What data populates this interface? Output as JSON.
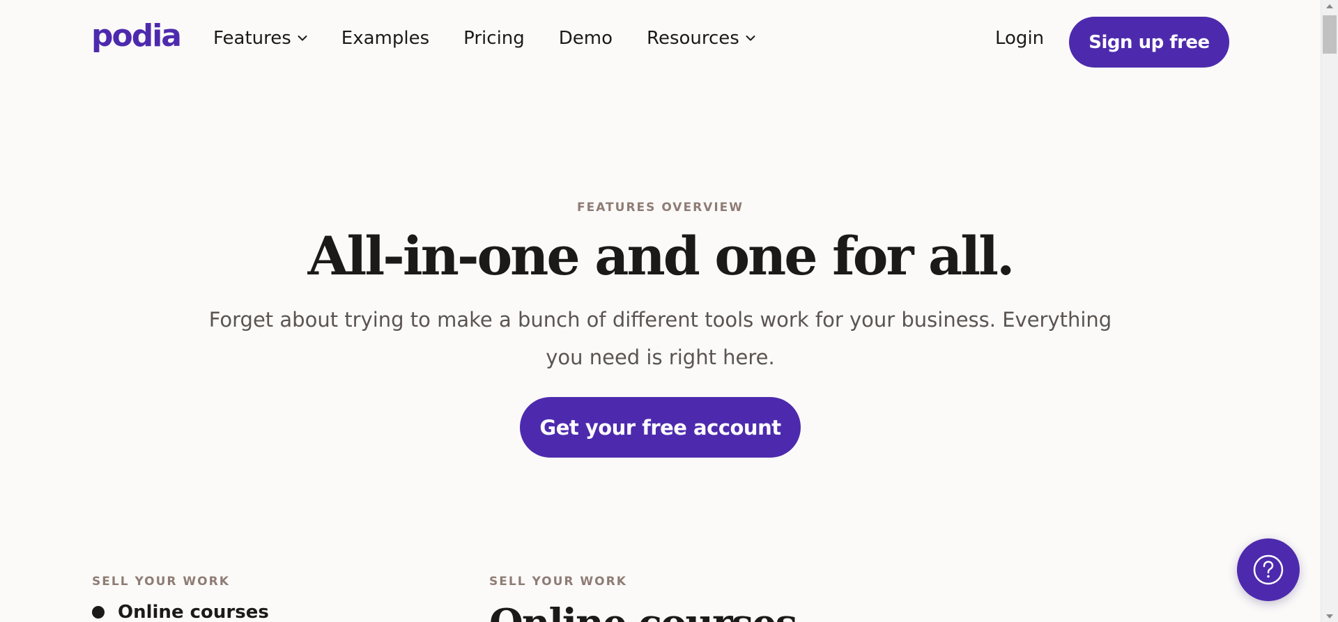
{
  "header": {
    "logo_text": "podia",
    "nav": [
      {
        "label": "Features",
        "has_dropdown": true
      },
      {
        "label": "Examples",
        "has_dropdown": false
      },
      {
        "label": "Pricing",
        "has_dropdown": false
      },
      {
        "label": "Demo",
        "has_dropdown": false
      },
      {
        "label": "Resources",
        "has_dropdown": true
      }
    ],
    "login_label": "Login",
    "signup_label": "Sign up free"
  },
  "hero": {
    "eyebrow": "FEATURES OVERVIEW",
    "title": "All-in-one and one for all.",
    "subtitle": "Forget about trying to make a bunch of different tools work for your business. Everything you need is right here.",
    "cta_label": "Get your free account"
  },
  "features": {
    "sidebar_label": "SELL YOUR WORK",
    "sidebar_items": [
      {
        "label": "Online courses"
      }
    ],
    "content_label": "SELL YOUR WORK",
    "content_title": "Online courses"
  },
  "help": {
    "icon": "question-mark-icon"
  },
  "colors": {
    "brand": "#4d2aad",
    "background": "#fbfaf9",
    "text": "#1c1a19",
    "muted_label": "#8e7c74",
    "body_text": "#5b5450"
  }
}
